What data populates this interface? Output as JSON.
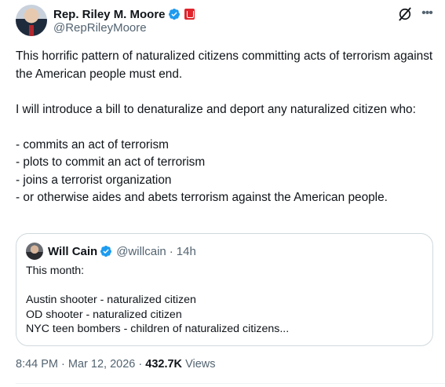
{
  "tweet": {
    "author": {
      "name": "Rep. Riley M. Moore",
      "handle": "@RepRileyMoore"
    },
    "text": "This horrific pattern of naturalized citizens committing acts of terrorism against the American people must end.\n\nI will introduce a bill to denaturalize and deport any naturalized citizen who:\n\n- commits an act of terrorism\n- plots to commit an act of terrorism\n- joins a terrorist organization\n- or otherwise aides and abets terrorism against the American people.",
    "quote": {
      "author": {
        "name": "Will Cain",
        "handle": "@willcain",
        "separator": "·",
        "time": "14h"
      },
      "text": "This month:\n\nAustin shooter - naturalized citizen\nOD shooter - naturalized citizen\nNYC teen bombers - children of naturalized citizens..."
    },
    "meta": {
      "time": "8:44 PM",
      "separator1": "·",
      "date": "Mar 12, 2026",
      "separator2": "·",
      "views_count": "432.7K",
      "views_label": "Views"
    }
  },
  "icons": {
    "verified": "verified-badge-icon",
    "government": "government-badge-icon",
    "grok": "grok-icon",
    "more": "more-icon"
  },
  "colors": {
    "text_primary": "#0f1419",
    "text_secondary": "#536471",
    "verified_blue": "#1d9bf0",
    "gov_red": "#e0242c",
    "border": "#cfd9de"
  }
}
